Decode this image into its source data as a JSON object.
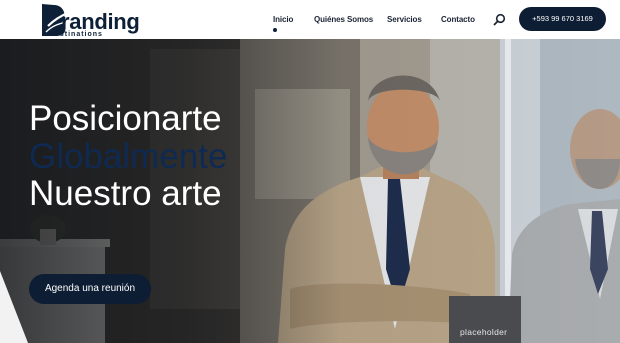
{
  "brand": {
    "name": "Branding",
    "name_rest": "randing",
    "name_initial": "B",
    "tagline": "estinations",
    "color": "#0e2038"
  },
  "nav": {
    "items": [
      {
        "label": "Inicio",
        "active": true
      },
      {
        "label": "Quiénes Somos",
        "active": false
      },
      {
        "label": "Servicios",
        "active": false
      },
      {
        "label": "Contacto",
        "active": false
      }
    ],
    "search_icon": "search-icon",
    "phone": "+593 99 670 3169"
  },
  "hero": {
    "lines": [
      "Posicionarte",
      "Globalmente",
      "Nuestro arte"
    ],
    "highlight_color": "#0f2a52",
    "cta": "Agenda una reunión",
    "placeholder": "placeholder"
  },
  "colors": {
    "accent": "#0d1d33",
    "nav_text": "#1c2434"
  }
}
